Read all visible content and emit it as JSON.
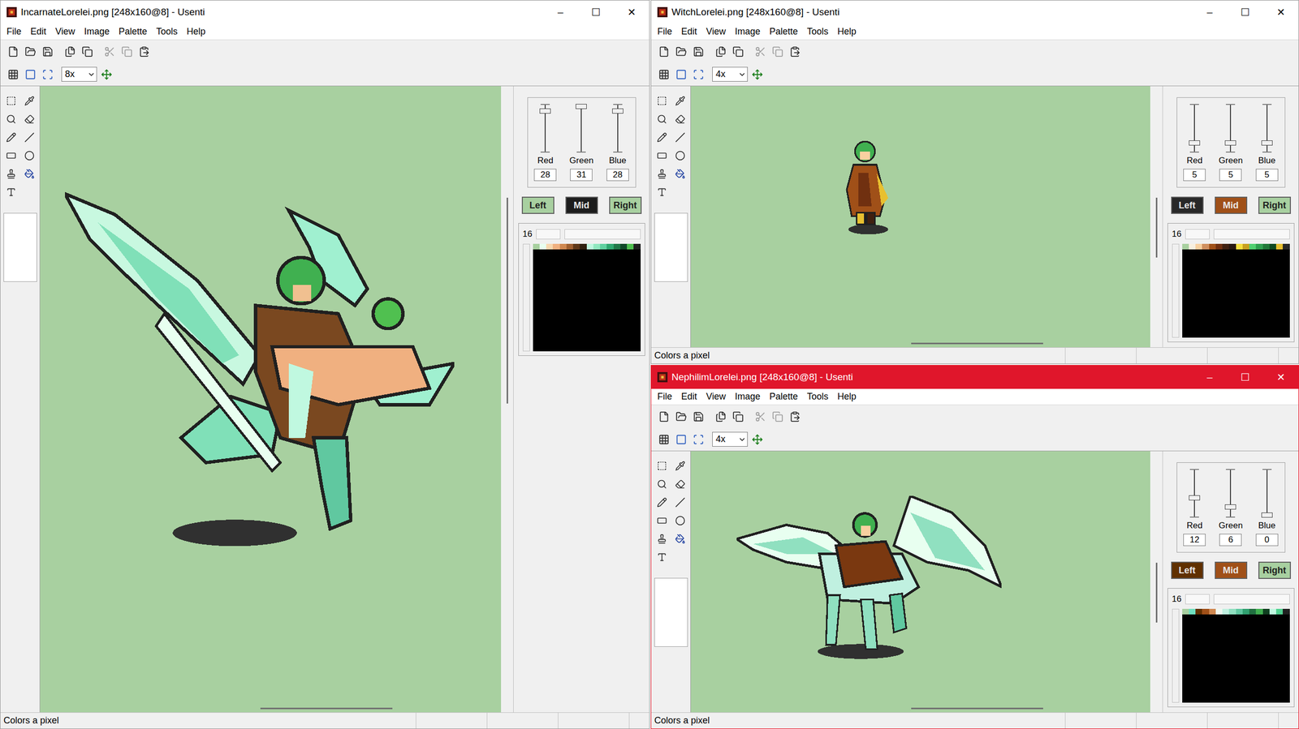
{
  "window_controls": [
    "–",
    "☐",
    "✕"
  ],
  "windows": [
    {
      "title": "IncarnateLorelei.png [248x160@8] - Usenti",
      "active": false,
      "menus": [
        "File",
        "Edit",
        "View",
        "Image",
        "Palette",
        "Tools",
        "Help"
      ],
      "zoom": "8x",
      "sliders": [
        {
          "label": "Red",
          "value": "28",
          "level": 0.9
        },
        {
          "label": "Green",
          "value": "31",
          "level": 1.0
        },
        {
          "label": "Blue",
          "value": "28",
          "level": 0.9
        }
      ],
      "buttons": [
        {
          "label": "Left",
          "color": "#a8d0a0"
        },
        {
          "label": "Mid",
          "color": "#1c1c1c"
        },
        {
          "label": "Right",
          "color": "#a8d0a0"
        }
      ],
      "palette": {
        "count": "16",
        "colors": [
          "#a8d0a0",
          "#e8fff0",
          "#f8d8b0",
          "#f0b080",
          "#d08850",
          "#a06030",
          "#603818",
          "#302010",
          "#c0f8e0",
          "#90e8c0",
          "#60d0a0",
          "#30a870",
          "#207848",
          "#104828",
          "#50c050",
          "#202020"
        ]
      },
      "status": "Colors a pixel",
      "sprite_kind": "incarnate"
    },
    {
      "title": "WitchLorelei.png [248x160@8] - Usenti",
      "active": false,
      "menus": [
        "File",
        "Edit",
        "View",
        "Image",
        "Palette",
        "Tools",
        "Help"
      ],
      "zoom": "4x",
      "sliders": [
        {
          "label": "Red",
          "value": "5",
          "level": 0.16
        },
        {
          "label": "Green",
          "value": "5",
          "level": 0.16
        },
        {
          "label": "Blue",
          "value": "5",
          "level": 0.16
        }
      ],
      "buttons": [
        {
          "label": "Left",
          "color": "#282828"
        },
        {
          "label": "Mid",
          "color": "#a05018"
        },
        {
          "label": "Right",
          "color": "#a8d0a0"
        }
      ],
      "palette": {
        "count": "16",
        "colors": [
          "#a8d0a0",
          "#f8f0e0",
          "#f8d0a0",
          "#d09060",
          "#a05018",
          "#703010",
          "#402010",
          "#281810",
          "#f8e040",
          "#c8a020",
          "#50d070",
          "#30a050",
          "#207838",
          "#104820",
          "#e8c030",
          "#282828"
        ]
      },
      "status": "Colors a pixel",
      "sprite_kind": "witch"
    },
    {
      "title": "NephilimLorelei.png [248x160@8] - Usenti",
      "active": true,
      "menus": [
        "File",
        "Edit",
        "View",
        "Image",
        "Palette",
        "Tools",
        "Help"
      ],
      "zoom": "4x",
      "sliders": [
        {
          "label": "Red",
          "value": "12",
          "level": 0.39
        },
        {
          "label": "Green",
          "value": "6",
          "level": 0.19
        },
        {
          "label": "Blue",
          "value": "0",
          "level": 0.0
        }
      ],
      "buttons": [
        {
          "label": "Left",
          "color": "#603000"
        },
        {
          "label": "Mid",
          "color": "#a05018"
        },
        {
          "label": "Right",
          "color": "#a8d0a0"
        }
      ],
      "palette": {
        "count": "16",
        "colors": [
          "#a8d0a0",
          "#70e0c0",
          "#603000",
          "#a05018",
          "#d08850",
          "#f0f8f0",
          "#c0f0e0",
          "#90e0c0",
          "#60c8a0",
          "#30a070",
          "#207040",
          "#40b050",
          "#104020",
          "#c0f8e0",
          "#50d090",
          "#202020"
        ]
      },
      "status": "Colors a pixel",
      "sprite_kind": "nephilim"
    }
  ]
}
